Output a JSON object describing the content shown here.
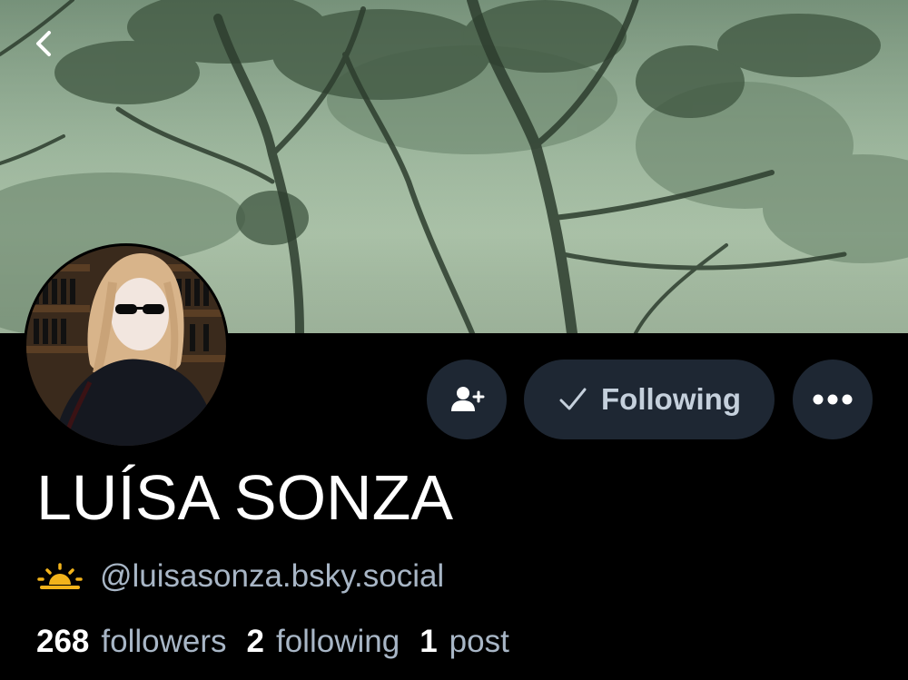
{
  "colors": {
    "background": "#000000",
    "button_bg": "#1e2733",
    "muted_text": "#a8b6c6",
    "banner_tint": "#9cb59c",
    "sun_emoji": "#f2b31b"
  },
  "header": {
    "back_icon": "chevron-left-icon",
    "banner_description_icon": "misty-trees-banner"
  },
  "actions": {
    "add_follow_icon": "person-plus-icon",
    "following_label": "Following",
    "following_icon": "checkmark-icon",
    "more_icon": "ellipsis-icon"
  },
  "profile": {
    "display_name": "LUÍSA SONZA",
    "emoji_icon": "sunrise-icon",
    "handle": "@luisasonza.bsky.social"
  },
  "stats": [
    {
      "number": "268",
      "label": "followers"
    },
    {
      "number": "2",
      "label": "following"
    },
    {
      "number": "1",
      "label": "post"
    }
  ]
}
